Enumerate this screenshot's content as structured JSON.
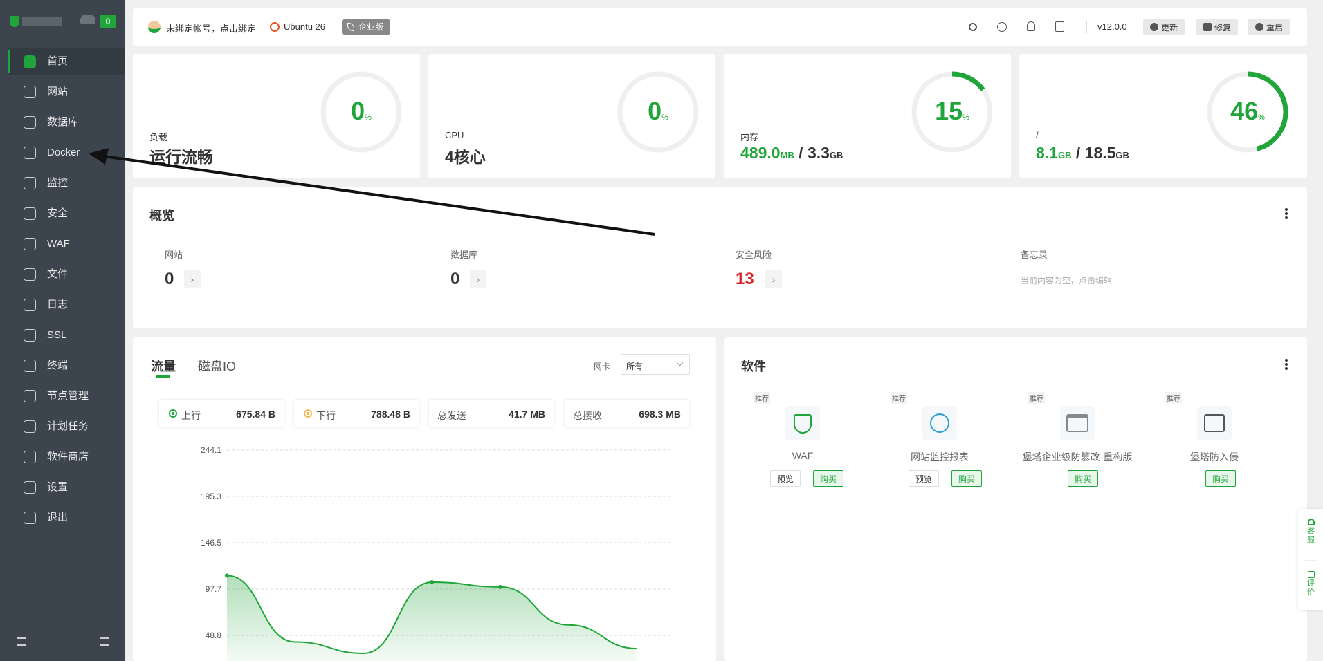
{
  "sidebar": {
    "badge": "0",
    "items": [
      {
        "label": "首页",
        "icon": "home-icon"
      },
      {
        "label": "网站",
        "icon": "website-icon"
      },
      {
        "label": "数据库",
        "icon": "database-icon"
      },
      {
        "label": "Docker",
        "icon": "docker-icon"
      },
      {
        "label": "监控",
        "icon": "monitor-icon"
      },
      {
        "label": "安全",
        "icon": "shield-icon"
      },
      {
        "label": "WAF",
        "icon": "waf-icon"
      },
      {
        "label": "文件",
        "icon": "folder-icon"
      },
      {
        "label": "日志",
        "icon": "log-icon"
      },
      {
        "label": "SSL",
        "icon": "ssl-icon"
      },
      {
        "label": "终端",
        "icon": "terminal-icon"
      },
      {
        "label": "节点管理",
        "icon": "node-icon"
      },
      {
        "label": "计划任务",
        "icon": "calendar-icon"
      },
      {
        "label": "软件商店",
        "icon": "store-icon"
      },
      {
        "label": "设置",
        "icon": "gear-icon"
      },
      {
        "label": "退出",
        "icon": "logout-icon"
      }
    ]
  },
  "topbar": {
    "account": "未绑定帐号，点击绑定",
    "os": "Ubuntu 26",
    "edition": "企业版",
    "version": "v12.0.0",
    "update": "更新",
    "repair": "修复",
    "restart": "重启"
  },
  "status": {
    "load": {
      "label": "负载",
      "value": "运行流畅",
      "percent": "0",
      "unit": "%"
    },
    "cpu": {
      "label": "CPU",
      "value": "4核心",
      "percent": "0",
      "unit": "%"
    },
    "memory": {
      "label": "内存",
      "used": "489.0",
      "used_unit": "MB",
      "sep": "/",
      "total": "3.3",
      "total_unit": "GB",
      "percent": "15",
      "unit": "%"
    },
    "disk": {
      "label": "/",
      "used": "8.1",
      "used_unit": "GB",
      "sep": "/",
      "total": "18.5",
      "total_unit": "GB",
      "percent": "46",
      "unit": "%"
    }
  },
  "overview": {
    "title": "概览",
    "items": [
      {
        "label": "网站",
        "value": "0"
      },
      {
        "label": "数据库",
        "value": "0"
      },
      {
        "label": "安全风险",
        "value": "13"
      }
    ],
    "memo_label": "备忘录",
    "memo_text": "当前内容为空，点击编辑"
  },
  "traffic": {
    "tab_active": "流量",
    "tab_other": "磁盘IO",
    "nic_label": "网卡",
    "nic_value": "所有",
    "up_label": "上行",
    "up_value": "675.84 B",
    "down_label": "下行",
    "down_value": "788.48 B",
    "sent_label": "总发送",
    "sent_value": "41.7 MB",
    "recv_label": "总接收",
    "recv_value": "698.3 MB"
  },
  "chart_data": {
    "type": "area",
    "y_ticks": [
      "244.1",
      "195.3",
      "146.5",
      "97.7",
      "48.8"
    ],
    "ylim": [
      0,
      244.1
    ],
    "series": [
      {
        "values": [
          112,
          42,
          30,
          105,
          100,
          60,
          35
        ]
      }
    ],
    "colors": {
      "line": "#20a53a",
      "fill": "#20a53a"
    }
  },
  "software": {
    "title": "软件",
    "items": [
      {
        "tag": "推荐",
        "name": "WAF",
        "preview": "预览",
        "buy": "购买",
        "icon": "waf-shield-icon"
      },
      {
        "tag": "推荐",
        "name": "网站监控报表",
        "preview": "预览",
        "buy": "购买",
        "icon": "radar-icon"
      },
      {
        "tag": "推荐",
        "name": "堡塔企业级防篡改-重构版",
        "buy": "购买",
        "icon": "browser-lock-icon"
      },
      {
        "tag": "推荐",
        "name": "堡塔防入侵",
        "buy": "购买",
        "icon": "terminal-lock-icon"
      }
    ]
  },
  "float": {
    "service": "客服",
    "review": "评价"
  },
  "colors": {
    "accent": "#20a53a",
    "sidebar": "#3c444d",
    "danger": "#d8232a"
  }
}
